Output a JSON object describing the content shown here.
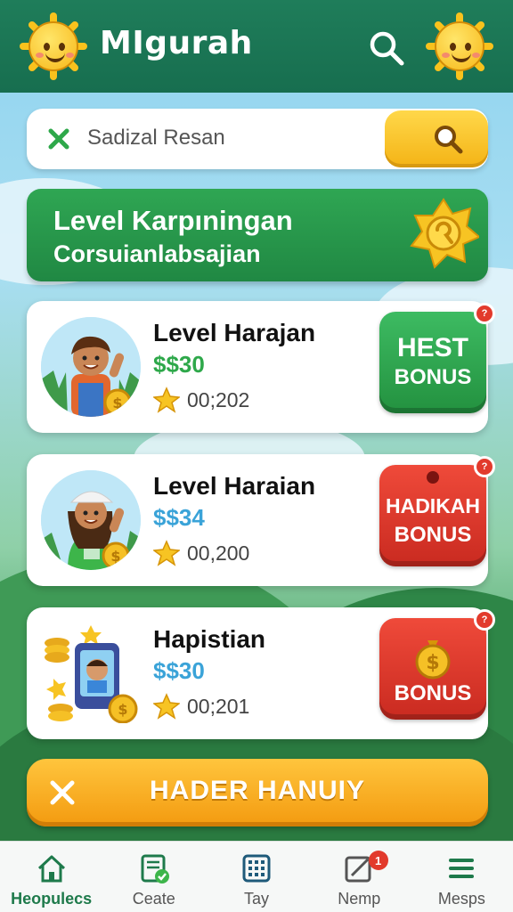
{
  "header": {
    "app_title": "MIgurah",
    "search_icon": "search-icon"
  },
  "search": {
    "value": "Sadizal Resan",
    "clear_icon": "close-icon",
    "button_icon": "search-icon"
  },
  "banner": {
    "title": "Level Karpıningan",
    "subtitle": "Corsuianlabsajian",
    "badge_icon": "gold-star-badge-icon"
  },
  "cards": [
    {
      "title": "Level Harajan",
      "price": "$$30",
      "price_color": "#2ea84a",
      "count": "00;202",
      "bonus_top": "HEST",
      "bonus_label": "BONUS",
      "bonus_color": "green",
      "notif": "?"
    },
    {
      "title": "Level Haraian",
      "price": "$$34",
      "price_color": "#3aa3d8",
      "count": "00,200",
      "bonus_top": "HADIKAH",
      "bonus_label": "BONUS",
      "bonus_color": "red",
      "notif": "?"
    },
    {
      "title": "Hapistian",
      "price": "$$30",
      "price_color": "#3aa3d8",
      "count": "00;201",
      "bonus_top": "",
      "bonus_label": "BONUS",
      "bonus_color": "red",
      "notif": "?"
    }
  ],
  "cta": {
    "label": "HADER HANUIY",
    "icon": "close-icon"
  },
  "bottom_nav": [
    {
      "label": "Heopulecs",
      "icon": "home-icon",
      "active": true
    },
    {
      "label": "Ceate",
      "icon": "document-icon",
      "active": false
    },
    {
      "label": "Tay",
      "icon": "grid-icon",
      "active": false
    },
    {
      "label": "Nemp",
      "icon": "edit-icon",
      "active": false,
      "badge": "1"
    },
    {
      "label": "Mesps",
      "icon": "menu-icon",
      "active": false
    }
  ]
}
